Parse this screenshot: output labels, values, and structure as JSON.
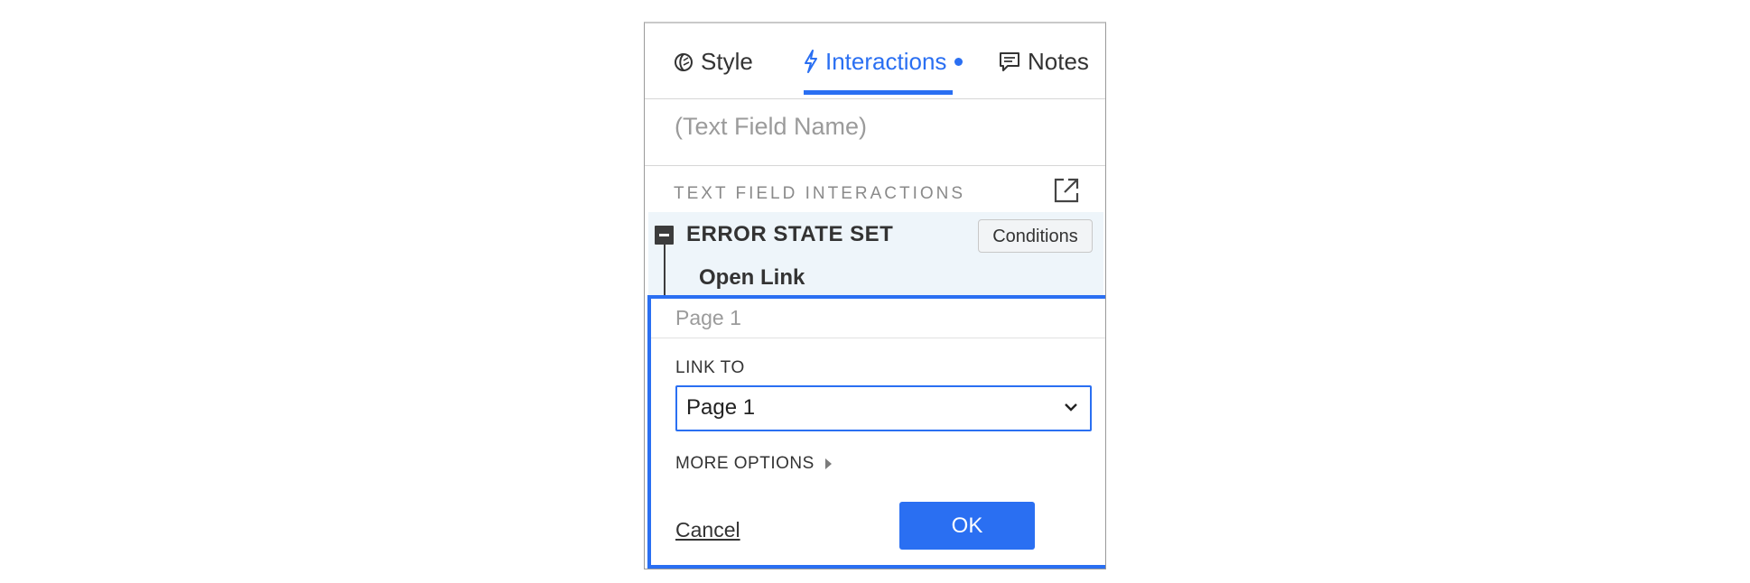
{
  "tabs": {
    "style": "Style",
    "interactions": "Interactions",
    "notes": "Notes"
  },
  "name_field": {
    "placeholder": "(Text Field Name)"
  },
  "section": {
    "title": "TEXT FIELD INTERACTIONS"
  },
  "event": {
    "title": "ERROR STATE SET",
    "conditions_label": "Conditions",
    "action": "Open Link"
  },
  "editor": {
    "page_text": "Page 1",
    "link_to_label": "LINK TO",
    "link_to_value": "Page 1",
    "more_options_label": "MORE OPTIONS",
    "cancel_label": "Cancel",
    "ok_label": "OK"
  },
  "colors": {
    "accent": "#2a6ff2",
    "event_bg": "#eef5fa"
  },
  "icons": {
    "style": "palette-leaf-icon",
    "interactions": "lightning-icon",
    "notes": "comment-icon",
    "export": "open-external-icon",
    "collapse": "minus-box-icon",
    "select": "chevron-down-icon",
    "more_options": "caret-right-icon"
  }
}
